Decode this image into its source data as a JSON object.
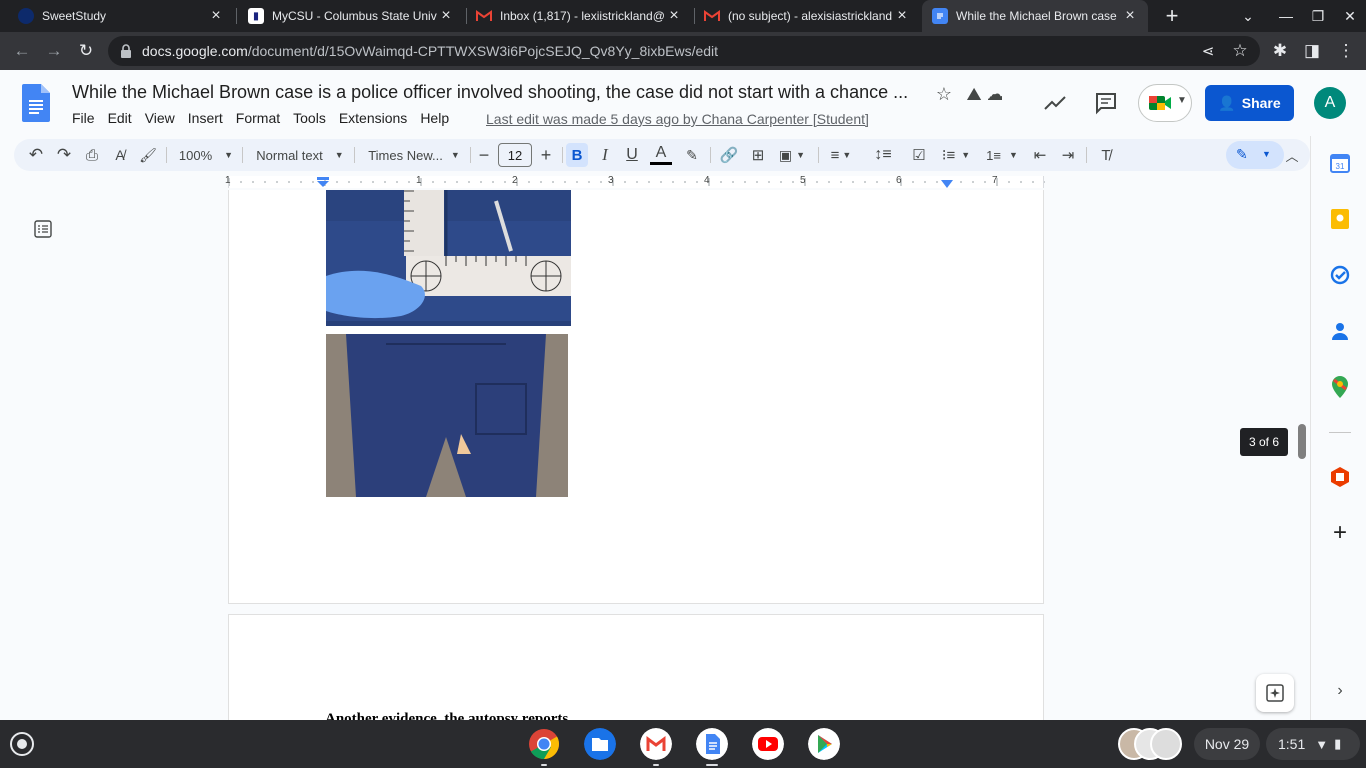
{
  "browser": {
    "tabs": [
      {
        "title": "SweetStudy",
        "active": false
      },
      {
        "title": "MyCSU - Columbus State Univ",
        "active": false
      },
      {
        "title": "Inbox (1,817) - lexiistrickland@",
        "active": false
      },
      {
        "title": "(no subject) - alexisiastrickland",
        "active": false
      },
      {
        "title": "While the Michael Brown case",
        "active": true
      }
    ],
    "url_host": "docs.google.com",
    "url_path": "/document/d/15OvWaimqd-CPTTWXSW3i6PojcSEJQ_Qv8Yy_8ixbEws/edit"
  },
  "docs": {
    "title": "While the Michael Brown case is a police officer involved shooting, the case did not start with a chance ...",
    "menu": [
      "File",
      "Edit",
      "View",
      "Insert",
      "Format",
      "Tools",
      "Extensions",
      "Help"
    ],
    "last_edit": "Last edit was made 5 days ago by Chana Carpenter [Student]",
    "share_label": "Share",
    "avatar_letter": "A",
    "toolbar": {
      "zoom": "100%",
      "style": "Normal text",
      "font": "Times New...",
      "font_size": "12",
      "bold": "B",
      "italic": "I",
      "underline": "U",
      "text_color": "A"
    },
    "ruler_numbers": [
      "1",
      "1",
      "2",
      "3",
      "4",
      "5",
      "6",
      "7"
    ],
    "page_indicator": "3 of 6",
    "next_page_heading": "Another evidence, the autopsy reports"
  },
  "shelf": {
    "date": "Nov 29",
    "time": "1:51"
  },
  "colors": {
    "accent": "#0b57d0",
    "chrome_dark": "#202124",
    "chrome_toolbar": "#35363a",
    "docs_bg": "#f9fbfd"
  }
}
